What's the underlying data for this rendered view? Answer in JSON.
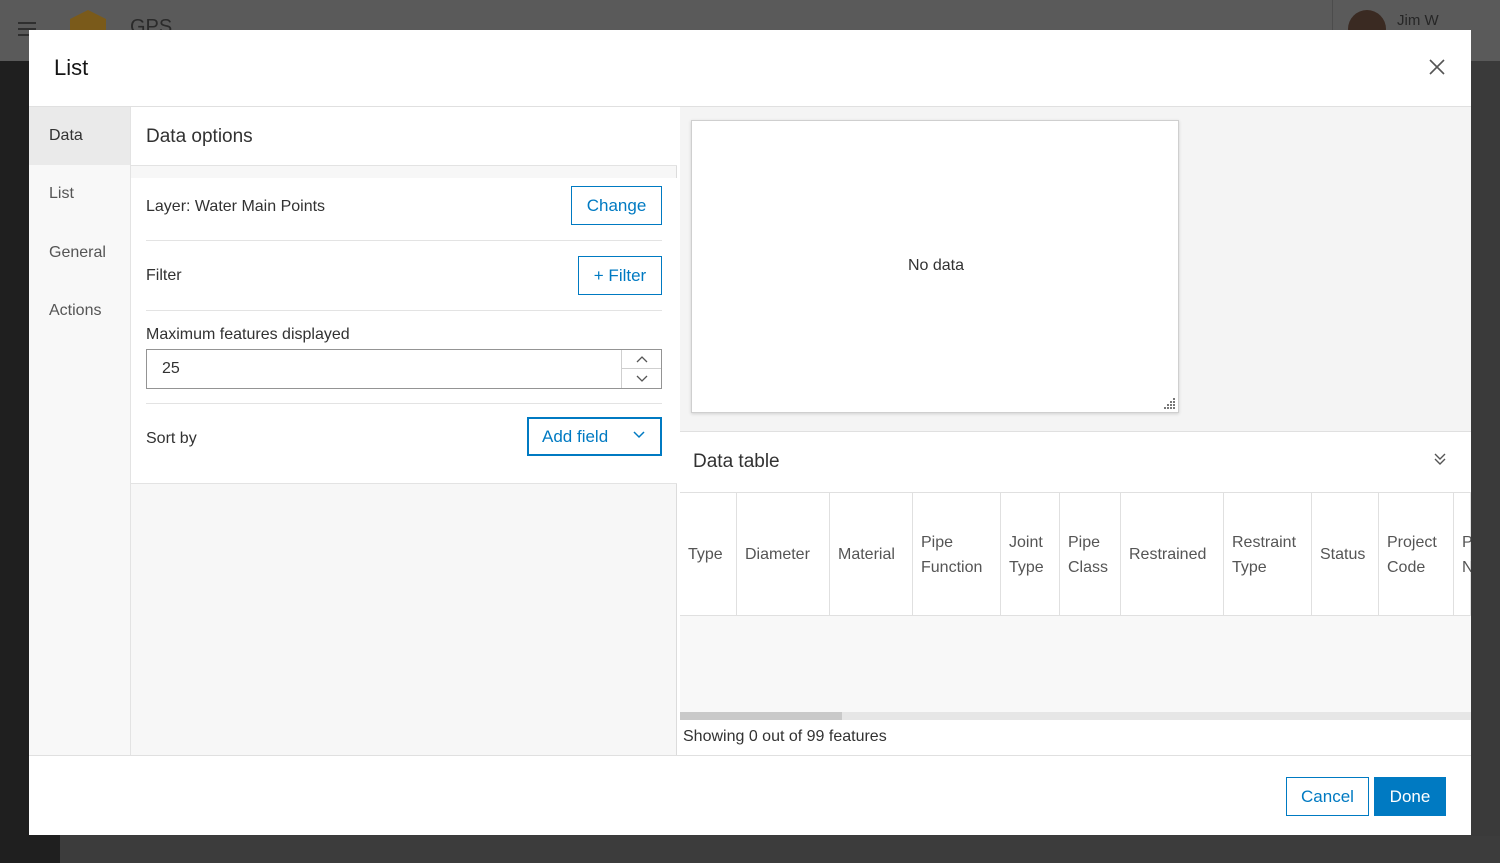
{
  "background": {
    "app_title": "GPS",
    "user_name": "Jim W"
  },
  "dialog": {
    "title": "List",
    "close_icon": "close-icon"
  },
  "side_nav": {
    "items": [
      {
        "label": "Data",
        "active": true
      },
      {
        "label": "List",
        "active": false
      },
      {
        "label": "General",
        "active": false
      },
      {
        "label": "Actions",
        "active": false
      }
    ]
  },
  "data_options": {
    "title": "Data options",
    "layer_label": "Layer: Water Main Points",
    "change_button": "Change",
    "filter_label": "Filter",
    "filter_button": "+ Filter",
    "max_features_label": "Maximum features displayed",
    "max_features_value": "25",
    "sort_label": "Sort by",
    "sort_dropdown": "Add field"
  },
  "preview": {
    "empty_text": "No data"
  },
  "data_table": {
    "title": "Data table",
    "columns": [
      "Type",
      "Diameter",
      "Material",
      "Pipe\nFunction",
      "Joint\nType",
      "Pipe\nClass",
      "Restrained",
      "Restraint\nType",
      "Status",
      "Project\nCode",
      "P\nN"
    ],
    "footer_text": "Showing 0 out of 99 features"
  },
  "footer": {
    "cancel_label": "Cancel",
    "done_label": "Done"
  },
  "colors": {
    "accent": "#007ac2",
    "overlay": "#3a3a3a"
  }
}
